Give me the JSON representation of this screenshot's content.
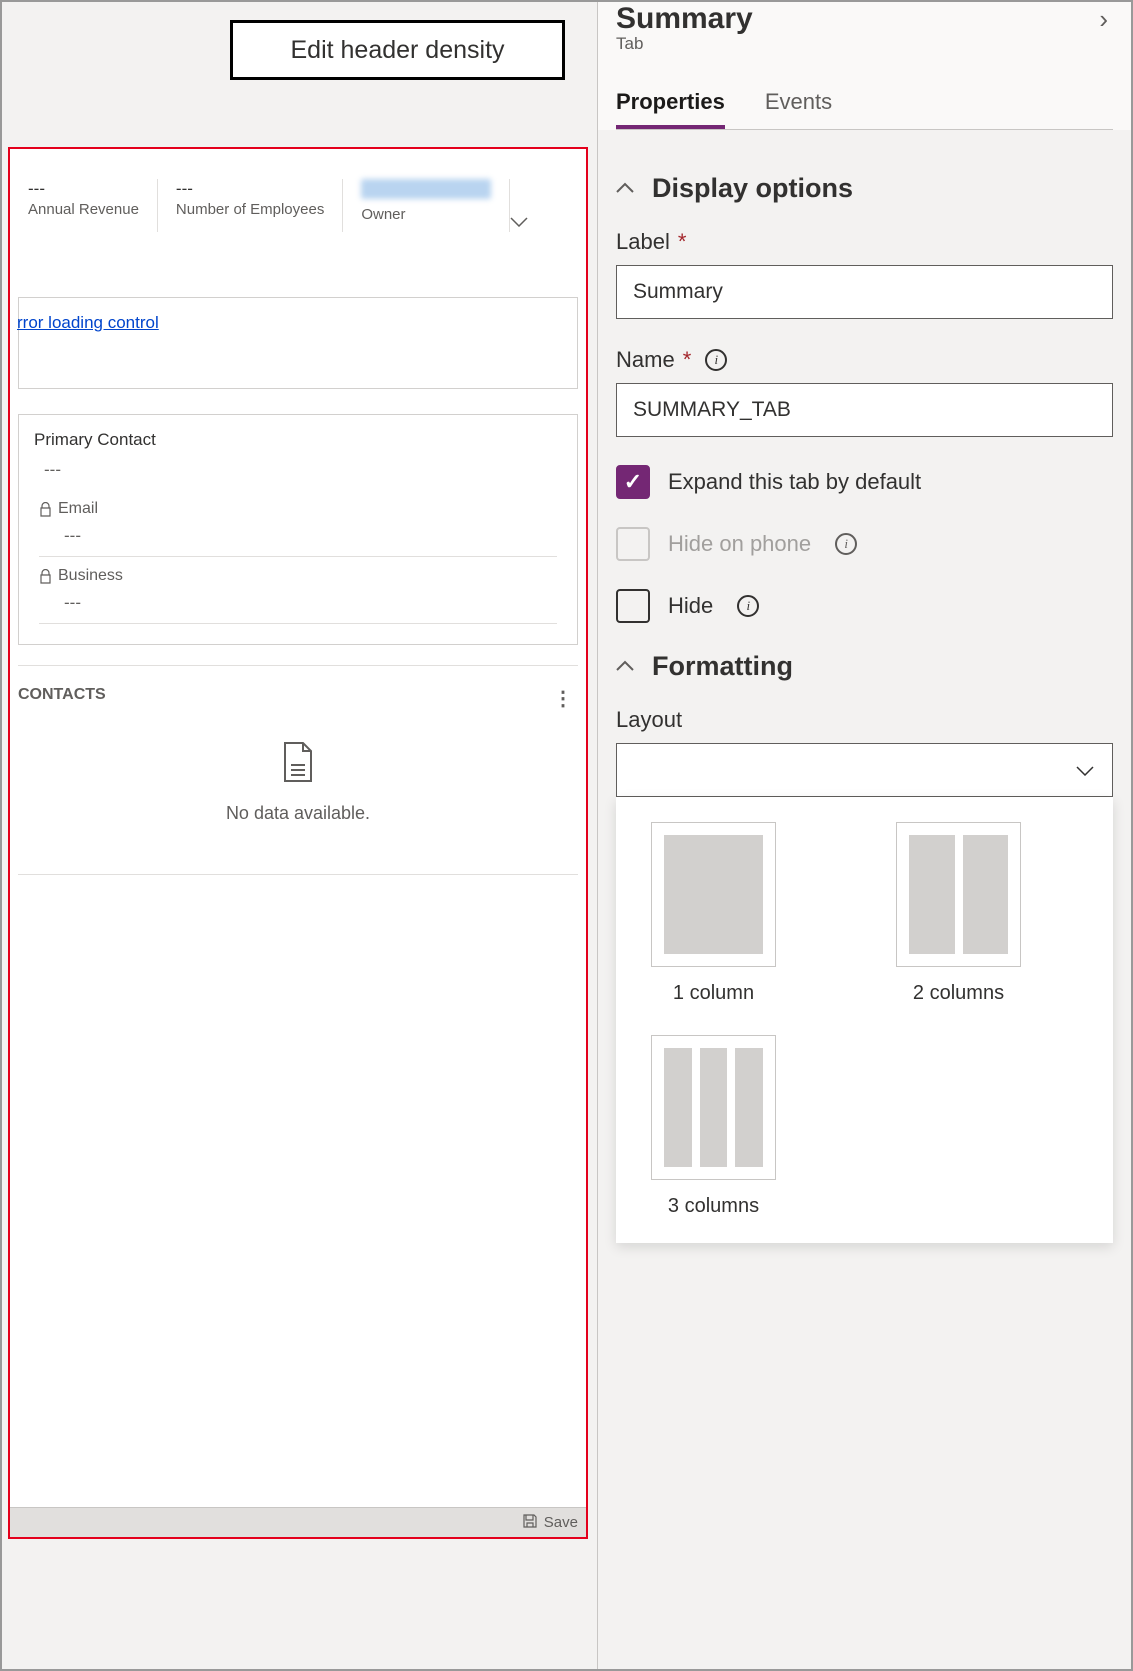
{
  "editHeaderBtn": "Edit header density",
  "headerFields": {
    "revenue": {
      "value": "---",
      "label": "Annual Revenue"
    },
    "employees": {
      "value": "---",
      "label": "Number of Employees"
    },
    "owner": {
      "label": "Owner"
    }
  },
  "errorLink": "rror loading control",
  "primaryContact": {
    "label": "Primary Contact",
    "value": "---",
    "email": {
      "label": "Email",
      "value": "---"
    },
    "business": {
      "label": "Business",
      "value": "---"
    }
  },
  "contactsSection": {
    "title": "CONTACTS",
    "empty": "No data available."
  },
  "statusSave": "Save",
  "panel": {
    "title": "Summary",
    "subtitle": "Tab"
  },
  "tabs": {
    "properties": "Properties",
    "events": "Events"
  },
  "displayOptions": {
    "header": "Display options",
    "labelField": "Label",
    "labelValue": "Summary",
    "nameField": "Name",
    "nameValue": "SUMMARY_TAB",
    "expand": "Expand this tab by default",
    "hidePhone": "Hide on phone",
    "hide": "Hide"
  },
  "formatting": {
    "header": "Formatting",
    "layoutLabel": "Layout",
    "options": {
      "one": "1 column",
      "two": "2 columns",
      "three": "3 columns"
    }
  }
}
